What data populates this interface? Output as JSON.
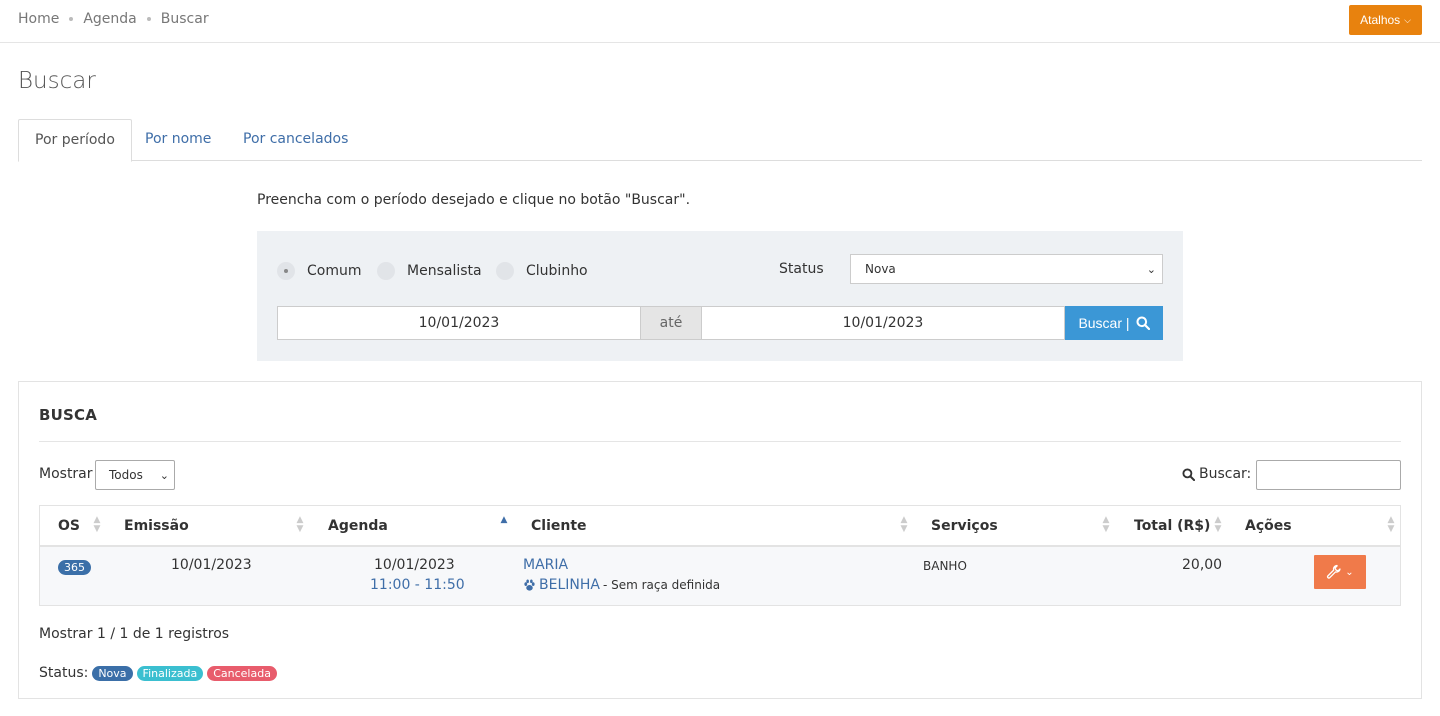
{
  "breadcrumb": [
    "Home",
    "Agenda",
    "Buscar"
  ],
  "shortcuts_label": "Atalhos",
  "page_title": "Buscar",
  "tabs": [
    {
      "label": "Por período",
      "active": true
    },
    {
      "label": "Por nome",
      "active": false
    },
    {
      "label": "Por cancelados",
      "active": false
    }
  ],
  "instruction": "Preencha com o período desejado e clique no botão \"Buscar\".",
  "filter": {
    "radios": [
      {
        "label": "Comum",
        "checked": true
      },
      {
        "label": "Mensalista",
        "checked": false
      },
      {
        "label": "Clubinho",
        "checked": false
      }
    ],
    "status_label": "Status",
    "status_value": "Nova",
    "date_from": "10/01/2023",
    "date_separator": "até",
    "date_to": "10/01/2023",
    "search_button": "Buscar |"
  },
  "panel": {
    "title": "BUSCA",
    "show_label": "Mostrar",
    "show_value": "Todos",
    "search_label": "Buscar:",
    "search_value": "",
    "columns": [
      "OS",
      "Emissão",
      "Agenda",
      "Cliente",
      "Serviços",
      "Total (R$)",
      "Ações"
    ],
    "rows": [
      {
        "os": "365",
        "emissao": "10/01/2023",
        "agenda_date": "10/01/2023",
        "agenda_time": "11:00 - 11:50",
        "cliente": "MARIA",
        "pet": "BELINHA",
        "pet_breed": "- Sem raça definida",
        "servicos": "BANHO",
        "total": "20,00"
      }
    ],
    "footer_info": "Mostrar 1 / 1 de 1 registros",
    "status_legend_label": "Status:",
    "status_legend": [
      {
        "label": "Nova",
        "color": "#3b6fa8"
      },
      {
        "label": "Finalizada",
        "color": "#3bbfd0"
      },
      {
        "label": "Cancelada",
        "color": "#e85c6c"
      }
    ]
  },
  "colors": {
    "accent": "#e8820e",
    "primary": "#3b97d6",
    "action": "#f07a4a",
    "link": "#3f6ea8"
  }
}
